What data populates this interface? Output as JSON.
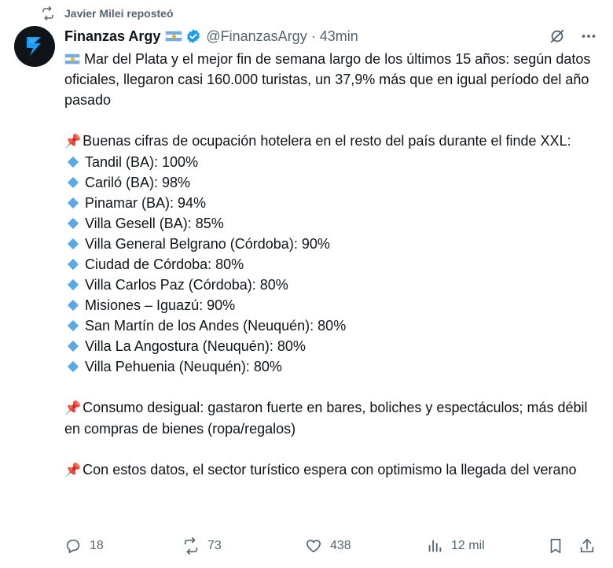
{
  "repost": {
    "label": "Javier Milei reposteó"
  },
  "tweet": {
    "author_name": "Finanzas Argy",
    "handle": "@FinanzasArgy",
    "separator": "·",
    "time": "43min",
    "paragraphs": {
      "intro": "Mar del Plata y el mejor fin de semana largo de los últimos 15 años: según datos oficiales, llegaron casi 160.000 turistas, un 37,9% más que en igual período del año pasado",
      "ocupacion_title": "Buenas cifras de ocupación hotelera en el resto del país durante el finde XXL:",
      "consumo": "Consumo desigual: gastaron fuerte en bares, boliches y espectáculos; más débil en compras de bienes (ropa/regalos)",
      "cierre": "Con estos datos, el sector turístico espera con optimismo la llegada del verano"
    },
    "ocupacion": [
      "Tandil (BA): 100%",
      "Cariló (BA): 98%",
      "Pinamar (BA): 94%",
      "Villa Gesell (BA): 85%",
      "Villa General Belgrano (Córdoba): 90%",
      "Ciudad de Córdoba: 80%",
      "Villa Carlos Paz (Córdoba): 80%",
      "Misiones – Iguazú: 90%",
      "San Martín de los Andes (Neuquén): 80%",
      "Villa La Angostura (Neuquén): 80%",
      "Villa Pehuenia (Neuquén): 80%"
    ]
  },
  "actions": {
    "replies": "18",
    "reposts": "73",
    "likes": "438",
    "views": "12 mil"
  },
  "icons": {
    "repost": "repost-icon",
    "verified": "verified-badge-icon",
    "grok": "grok-icon",
    "more": "more-icon",
    "reply": "reply-icon",
    "like": "heart-icon",
    "views": "views-icon",
    "bookmark": "bookmark-icon",
    "share": "share-icon",
    "pin": "pushpin-icon",
    "diamond": "blue-diamond-icon"
  },
  "colors": {
    "text": "#0f1419",
    "secondary": "#536471",
    "verified": "#1d9bf0",
    "diamond": "#5aa9e6"
  }
}
